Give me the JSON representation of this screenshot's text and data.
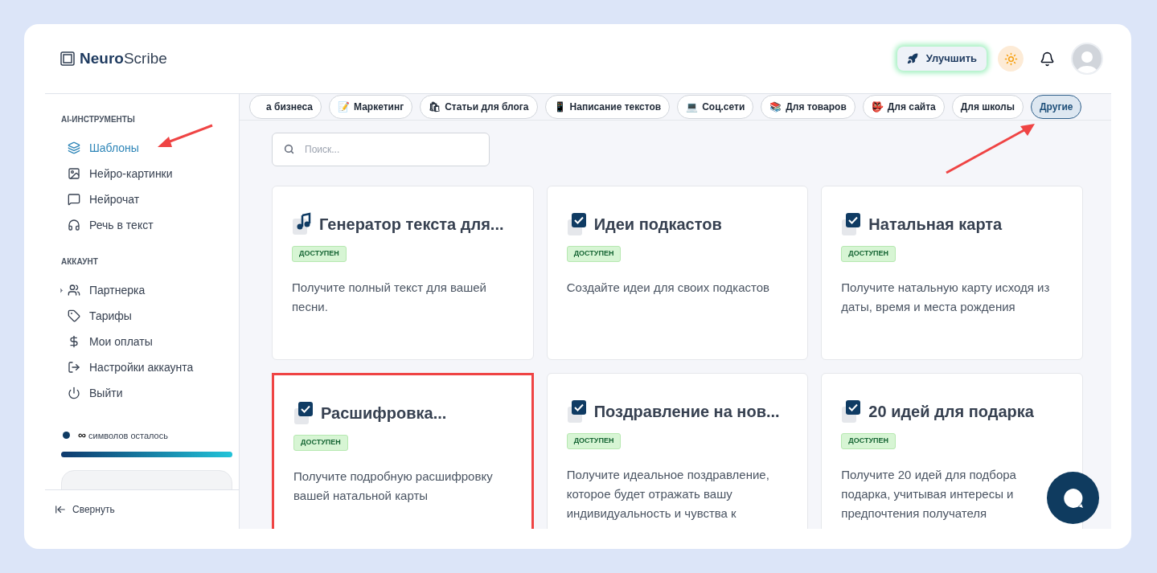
{
  "logo": {
    "bold": "Neuro",
    "light": "Scribe"
  },
  "header": {
    "upgrade": "Улучшить"
  },
  "sidebar": {
    "sections": [
      {
        "title": "AI-ИНСТРУМЕНТЫ",
        "items": [
          {
            "label": "Шаблоны",
            "selected": true,
            "expandable": false
          },
          {
            "label": "Нейро-картинки",
            "selected": false,
            "expandable": false
          },
          {
            "label": "Нейрочат",
            "selected": false,
            "expandable": false
          },
          {
            "label": "Речь в текст",
            "selected": false,
            "expandable": false
          }
        ]
      },
      {
        "title": "АККАУНТ",
        "items": [
          {
            "label": "Партнерка",
            "selected": false,
            "expandable": true
          },
          {
            "label": "Тарифы",
            "selected": false,
            "expandable": false
          },
          {
            "label": "Мои оплаты",
            "selected": false,
            "expandable": false
          },
          {
            "label": "Настройки аккаунта",
            "selected": false,
            "expandable": false
          },
          {
            "label": "Выйти",
            "selected": false,
            "expandable": false
          }
        ]
      }
    ],
    "credits": {
      "amount": "∞",
      "label": "символов осталось",
      "level": 1
    },
    "collapse": "Свернуть"
  },
  "categories": [
    {
      "label": "а бизнеса",
      "selected": false
    },
    {
      "emoji": "📝",
      "label": "Маркетинг",
      "selected": false
    },
    {
      "emoji": "🛍",
      "label": "Статьи для блога",
      "selected": false
    },
    {
      "emoji": "📱",
      "label": "Написание текстов",
      "selected": false
    },
    {
      "emoji": "💻",
      "label": "Соц.сети",
      "selected": false
    },
    {
      "emoji": "📚",
      "label": "Для товаров",
      "selected": false
    },
    {
      "emoji": "👺",
      "label": "Для сайта",
      "selected": false
    },
    {
      "label": "Для школы",
      "selected": false
    },
    {
      "label": "Другие",
      "selected": true
    }
  ],
  "search": {
    "placeholder": "Поиск..."
  },
  "cards": [
    {
      "kind": "music",
      "title": "Генератор текста для...",
      "badge": "ДОСТУПЕН",
      "description": "Получите полный текст для вашей песни.",
      "highlighted": false
    },
    {
      "kind": "check",
      "title": "Идеи подкастов",
      "badge": "ДОСТУПЕН",
      "description": "Создайте идеи для своих подкастов",
      "highlighted": false
    },
    {
      "kind": "check",
      "title": "Натальная карта",
      "badge": "ДОСТУПЕН",
      "description": "Получите натальную карту исходя из даты, время и места рождения",
      "highlighted": false
    },
    {
      "kind": "check",
      "title": "Расшифровка...",
      "badge": "ДОСТУПЕН",
      "description": "Получите подробную расшифровку вашей натальной карты",
      "highlighted": true
    },
    {
      "kind": "check",
      "title": "Поздравление на нов...",
      "badge": "ДОСТУПЕН",
      "description": "Получите идеальное поздравление, которое будет отражать вашу индивидуальность и чувства к",
      "highlighted": false
    },
    {
      "kind": "check",
      "title": "20 идей для подарка",
      "badge": "ДОСТУПЕН",
      "description": "Получите 20 идей для подбора подарка, учитывая интересы и предпочтения получателя",
      "highlighted": false
    }
  ]
}
